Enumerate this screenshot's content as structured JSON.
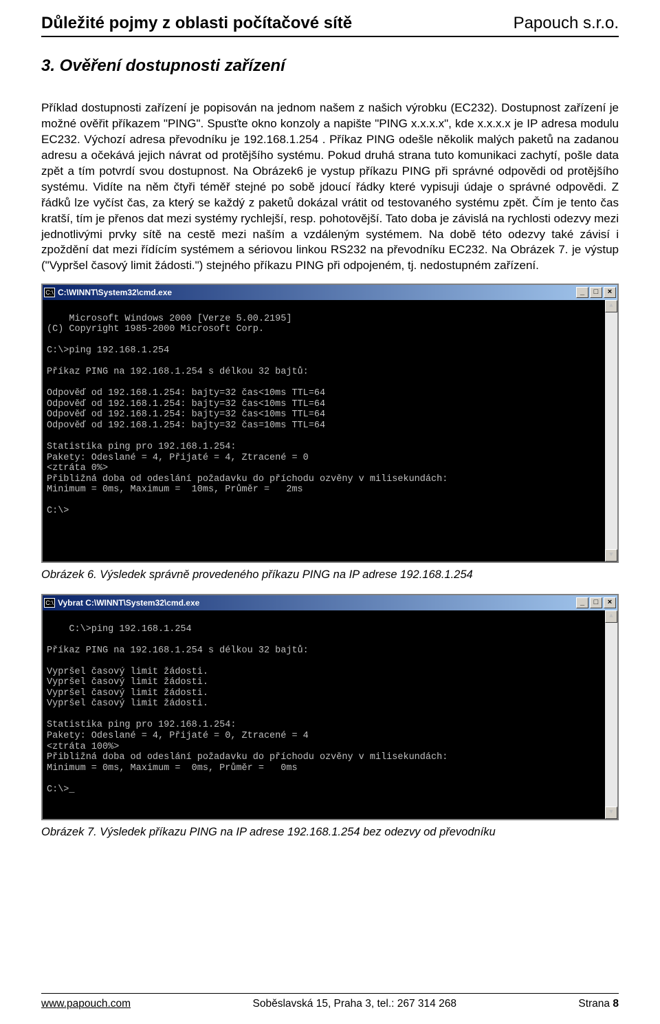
{
  "header": {
    "left": "Důležité pojmy z oblasti počítačové sítě",
    "right": "Papouch s.r.o."
  },
  "section_title": "3. Ověření dostupnosti zařízení",
  "body_text": "Příklad dostupnosti zařízení je popisován na jednom našem z našich výrobku (EC232). Dostupnost zařízení je možné ověřit příkazem \"PING\". Spusťte okno konzoly a napište \"PING x.x.x.x\", kde x.x.x.x je IP adresa modulu EC232. Výchozí adresa převodníku je 192.168.1.254 . Příkaz PING odešle několik malých paketů na zadanou adresu a očekává jejich návrat od protějšího systému. Pokud druhá strana tuto komunikaci zachytí, pošle data zpět a tím potvrdí svou dostupnost. Na Obrázek6 je vystup příkazu PING při správné odpovědi od protějšího systému. Vidíte na něm čtyři téměř stejné po sobě jdoucí řádky které vypisuji údaje o správné odpovědi. Z řádků lze vyčíst čas, za který se každý z paketů dokázal vrátit od testovaného systému zpět. Čím je tento čas kratší, tím je přenos dat mezi systémy rychlejší, resp. pohotovější. Tato doba je závislá na rychlosti odezvy mezi jednotlivými prvky sítě na cestě mezi naším a vzdáleným systémem. Na době této odezvy také závisí i zpoždění dat mezi řídícím systémem a sériovou linkou RS232 na převodníku EC232. Na Obrázek 7. je výstup (\"Vypršel časový limit žádosti.\") stejného příkazu PING při odpojeném, tj. nedostupném zařízení.",
  "window1": {
    "title": "C:\\WINNT\\System32\\cmd.exe",
    "icon": "cmd-icon",
    "min": "_",
    "max": "□",
    "close": "×",
    "content": "Microsoft Windows 2000 [Verze 5.00.2195]\n(C) Copyright 1985-2000 Microsoft Corp.\n\nC:\\>ping 192.168.1.254\n\nPříkaz PING na 192.168.1.254 s délkou 32 bajtů:\n\nOdpověď od 192.168.1.254: bajty=32 čas<10ms TTL=64\nOdpověď od 192.168.1.254: bajty=32 čas<10ms TTL=64\nOdpověď od 192.168.1.254: bajty=32 čas<10ms TTL=64\nOdpověď od 192.168.1.254: bajty=32 čas=10ms TTL=64\n\nStatistika ping pro 192.168.1.254:\nPakety: Odeslané = 4, Přijaté = 4, Ztracené = 0\n<ztráta 0%>\nPřibližná doba od odeslání požadavku do příchodu ozvěny v milisekundách:\nMinimum = 0ms, Maximum =  10ms, Průměr =   2ms\n\nC:\\>"
  },
  "caption1": "Obrázek 6.  Výsledek správně provedeného příkazu PING na IP adrese 192.168.1.254",
  "window2": {
    "title": "Vybrat C:\\WINNT\\System32\\cmd.exe",
    "content": "C:\\>ping 192.168.1.254\n\nPříkaz PING na 192.168.1.254 s délkou 32 bajtů:\n\nVypršel časový limit žádosti.\nVypršel časový limit žádosti.\nVypršel časový limit žádosti.\nVypršel časový limit žádosti.\n\nStatistika ping pro 192.168.1.254:\nPakety: Odeslané = 4, Přijaté = 0, Ztracené = 4\n<ztráta 100%>\nPřibližná doba od odeslání požadavku do příchodu ozvěny v milisekundách:\nMinimum = 0ms, Maximum =  0ms, Průměr =   0ms\n\nC:\\>_"
  },
  "caption2": "Obrázek 7.  Výsledek příkazu PING na IP adrese 192.168.1.254 bez odezvy od převodníku",
  "footer": {
    "left": "www.papouch.com",
    "center": "Soběslavská 15, Praha 3, tel.: 267 314 268",
    "right_label": "Strana ",
    "right_num": "8"
  }
}
